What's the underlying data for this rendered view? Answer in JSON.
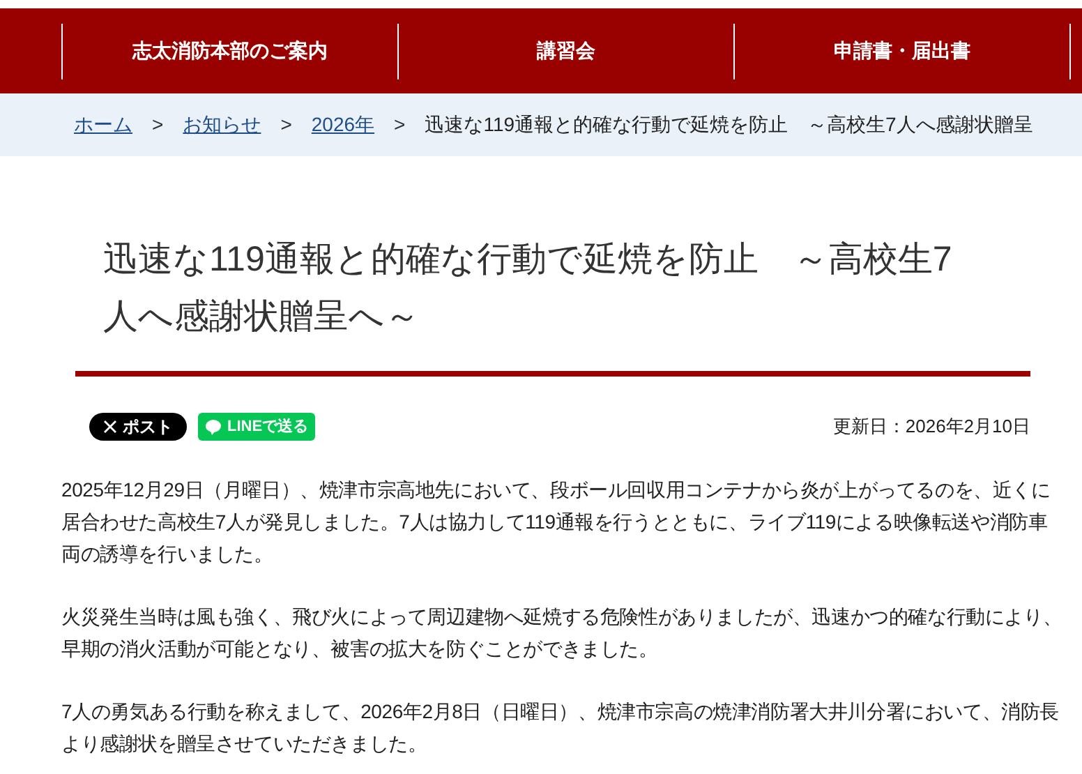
{
  "nav": [
    {
      "label": "志太消防本部のご案内"
    },
    {
      "label": "講習会"
    },
    {
      "label": "申請書・届出書"
    }
  ],
  "breadcrumb": [
    {
      "label": "ホーム",
      "kind": "link"
    },
    {
      "label": "お知らせ",
      "kind": "link"
    },
    {
      "label": "2026年",
      "kind": "link"
    },
    {
      "label": "迅速な119通報と的確な行動で延焼を防止　～高校生7人へ感謝状贈呈",
      "kind": "current"
    }
  ],
  "breadcrumb_separator": ">",
  "title": "迅速な119通報と的確な行動で延焼を防止　～高校生7人へ感謝状贈呈へ～",
  "share": [
    {
      "label": "ポスト",
      "kind": "x"
    },
    {
      "label": "LINEで送る",
      "kind": "line"
    }
  ],
  "updated": "更新日：2026年2月10日",
  "paragraphs": [
    "2025年12月29日（月曜日）、焼津市宗高地先において、段ボール回収用コンテナから炎が上がってるのを、近くに居合わせた高校生7人が発見しました。7人は協力して119通報を行うとともに、ライブ119による映像転送や消防車両の誘導を行いました。",
    "火災発生当時は風も強く、飛び火によって周辺建物へ延焼する危険性がありましたが、迅速かつ的確な行動により、早期の消火活動が可能となり、被害の拡大を防ぐことができました。",
    "7人の勇気ある行動を称えまして、2026年2月8日（日曜日）、焼津市宗高の焼津消防署大井川分署において、消防長より感謝状を贈呈させていただきました。"
  ]
}
